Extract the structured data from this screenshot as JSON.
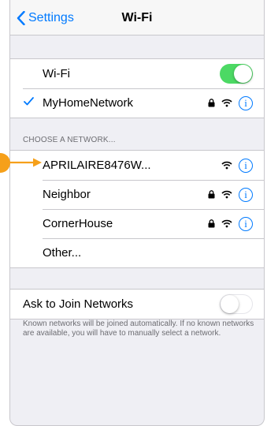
{
  "nav": {
    "back_label": "Settings",
    "title": "Wi-Fi"
  },
  "wifi_toggle": {
    "label": "Wi-Fi",
    "state": "on"
  },
  "connected": {
    "name": "MyHomeNetwork",
    "secured": true
  },
  "choose_header": "CHOOSE A NETWORK...",
  "networks": [
    {
      "name": "APRILAIRE8476W...",
      "secured": false,
      "highlighted": true
    },
    {
      "name": "Neighbor",
      "secured": true
    },
    {
      "name": "CornerHouse",
      "secured": true
    },
    {
      "name": "Other..."
    }
  ],
  "ask_to_join": {
    "label": "Ask to Join Networks",
    "state": "off"
  },
  "footer_note": "Known networks will be joined automatically. If no known networks are available, you will have to manually select a network.",
  "icons": {
    "info": "i"
  },
  "colors": {
    "accent": "#007aff",
    "toggle_on": "#4cd964",
    "callout": "#f6a01a"
  }
}
